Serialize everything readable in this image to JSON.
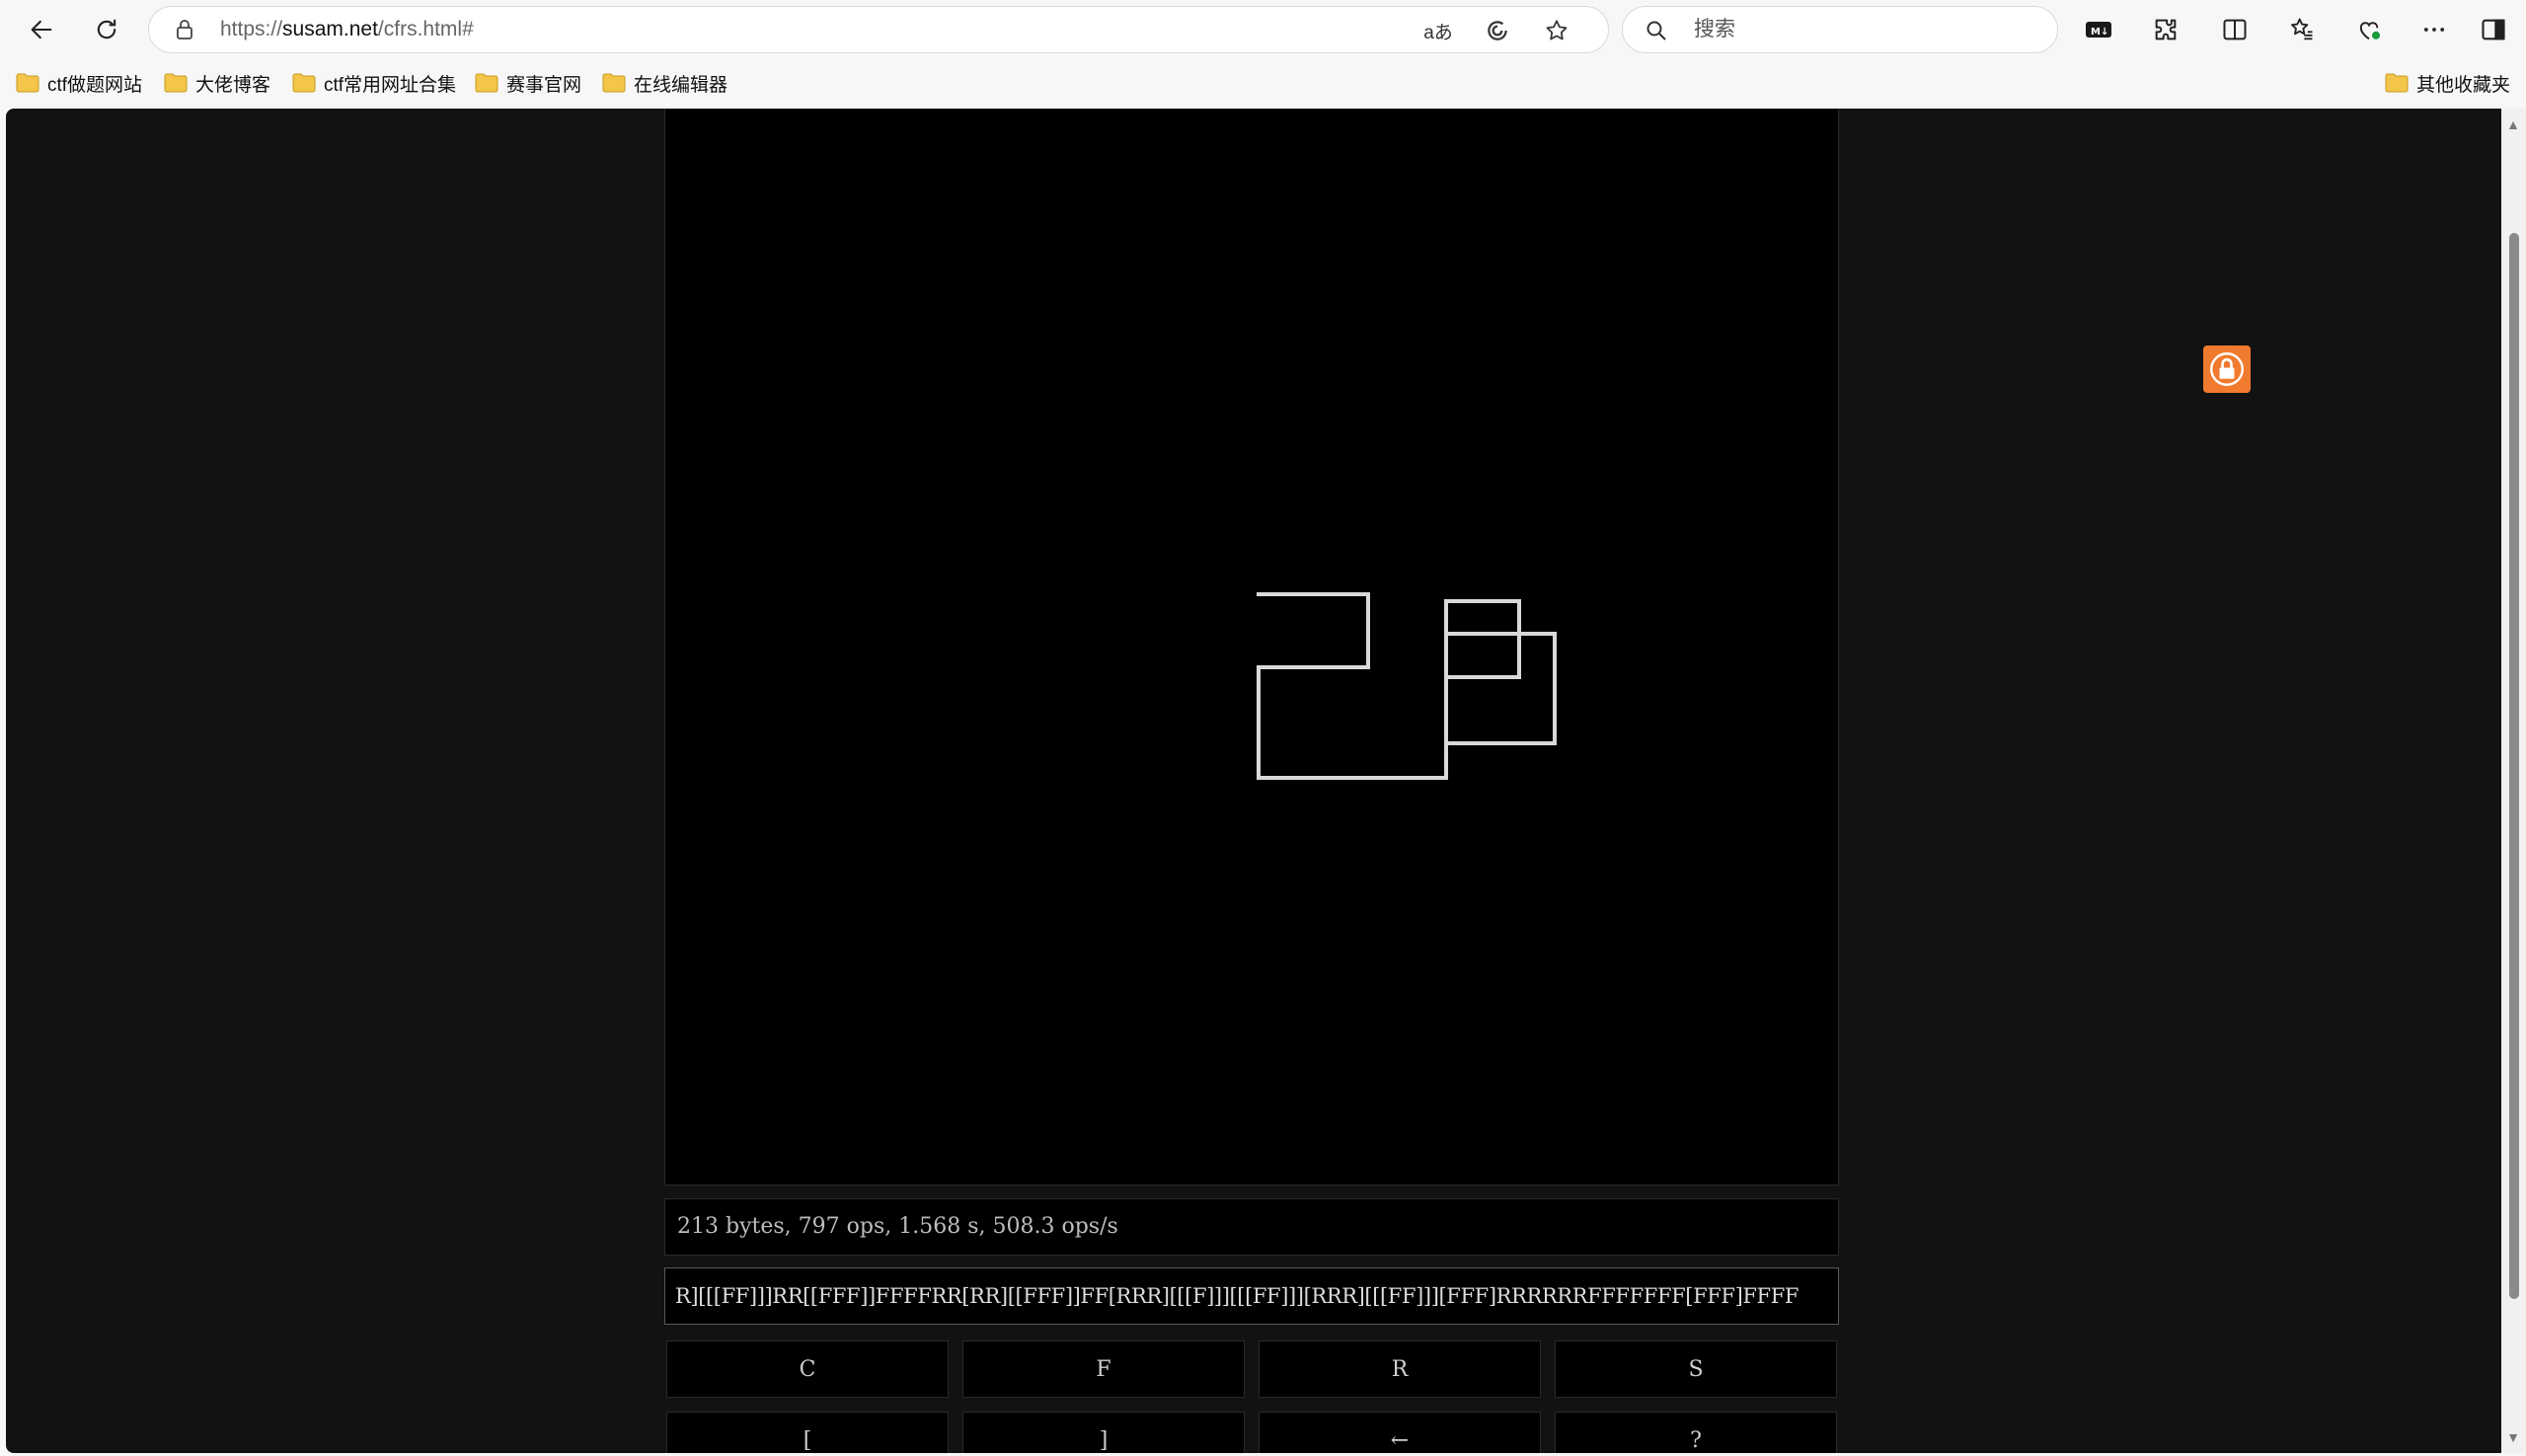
{
  "browser": {
    "url_prefix": "https://",
    "url_domain": "susam.net",
    "url_path": "/cfrs.html#",
    "search_placeholder": "搜索",
    "read_aloud_icon": "aあ"
  },
  "bookmarks": [
    {
      "label": "ctf做题网站"
    },
    {
      "label": "大佬博客"
    },
    {
      "label": "ctf常用网址合集"
    },
    {
      "label": "赛事官网"
    },
    {
      "label": "在线编辑器"
    }
  ],
  "other_bookmarks": "其他收藏夹",
  "app": {
    "status": "213 bytes, 797 ops, 1.568 s, 508.3 ops/s",
    "code": "R][[[FF]]]RR[[FFF]]FFFFRR[RR][[FFF]]FF[RRR][[[F]]][[[FF]]][RRR][[[FF]]][FFF]RRRRRRFFFFFFF[FFF]FFFF",
    "keys_row1": [
      "C",
      "F",
      "R",
      "S"
    ],
    "keys_row2": [
      "[",
      "]",
      "←",
      "?"
    ]
  },
  "colors": {
    "page_bg": "#121212",
    "canvas_bg": "#000000",
    "stroke": "#d9d9d9",
    "lock_badge": "#f07a2d"
  }
}
